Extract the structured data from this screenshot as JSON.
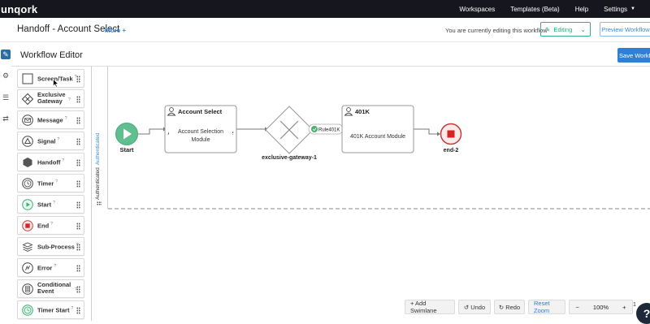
{
  "topbar": {
    "brand": "unqork",
    "nav": [
      "Workspaces",
      "Templates (Beta)",
      "Help",
      "Settings"
    ]
  },
  "header": {
    "title": "Handoff - Account Select",
    "more": "More +",
    "editing_note": "You are currently editing this workflow",
    "editing_label": "Editing",
    "preview_label": "Preview Workflow"
  },
  "editor": {
    "title": "Workflow Editor",
    "save_label": "Save Workflow"
  },
  "palette": [
    {
      "label": "Screen/Task",
      "icon": "screen-task-icon"
    },
    {
      "label": "Exclusive Gateway",
      "icon": "exclusive-gateway-icon"
    },
    {
      "label": "Message",
      "icon": "message-icon"
    },
    {
      "label": "Signal",
      "icon": "signal-icon"
    },
    {
      "label": "Handoff",
      "icon": "handoff-icon"
    },
    {
      "label": "Timer",
      "icon": "timer-icon"
    },
    {
      "label": "Start",
      "icon": "start-icon"
    },
    {
      "label": "End",
      "icon": "end-icon"
    },
    {
      "label": "Sub-Process",
      "icon": "sub-process-icon"
    },
    {
      "label": "Error",
      "icon": "error-icon"
    },
    {
      "label": "Conditional Event",
      "icon": "conditional-event-icon"
    },
    {
      "label": "Timer Start",
      "icon": "timer-start-icon"
    }
  ],
  "swimlane": {
    "label": "Authenticated",
    "sublabel": "Authenticated"
  },
  "workflow": {
    "start_label": "Start",
    "task1": {
      "title": "Account Select",
      "body": "Account Selection Module"
    },
    "gateway_label": "exclusive-gateway-1",
    "condition_label": "Rule401K",
    "task2": {
      "title": "401K",
      "body": "401K Account Module"
    },
    "end_label": "end-2"
  },
  "bottombar": {
    "add_swimlane": "+ Add Swimlane",
    "undo": "Undo",
    "redo": "Redo",
    "reset_zoom": "Reset Zoom",
    "zoom_out": "−",
    "zoom_level": "100%",
    "zoom_in": "+",
    "page": "1",
    "help": "?"
  },
  "colors": {
    "topbar": "#16161e",
    "accent": "#2e7fd8",
    "editing": "#2aa876",
    "start_fill": "#5fbf8f",
    "end_stroke": "#c83a3a",
    "end_fill": "#d42424"
  }
}
